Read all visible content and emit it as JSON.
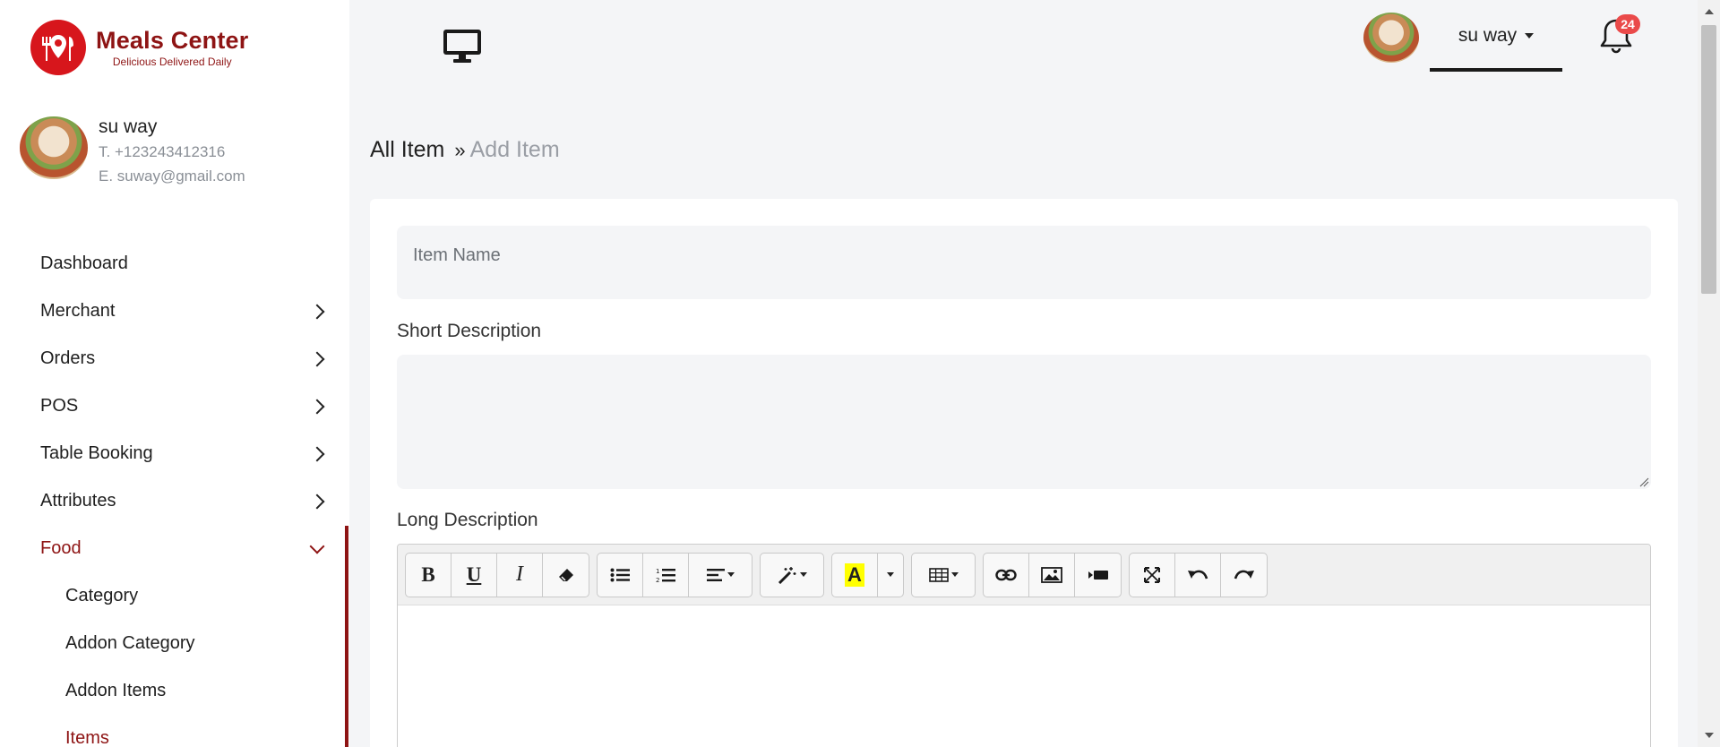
{
  "brand": {
    "title": "Meals Center",
    "tagline": "Delicious Delivered Daily",
    "color": "#8e1414"
  },
  "profile": {
    "name": "su way",
    "phone": "T. +123243412316",
    "email": "E. suway@gmail.com"
  },
  "nav": {
    "items": [
      {
        "label": "Dashboard",
        "has_chevron": false
      },
      {
        "label": "Merchant",
        "has_chevron": true
      },
      {
        "label": "Orders",
        "has_chevron": true
      },
      {
        "label": "POS",
        "has_chevron": true
      },
      {
        "label": "Table Booking",
        "has_chevron": true
      },
      {
        "label": "Attributes",
        "has_chevron": true
      },
      {
        "label": "Food",
        "has_chevron": true,
        "expanded": true,
        "active": true
      }
    ],
    "food_sub": [
      {
        "label": "Category"
      },
      {
        "label": "Addon Category"
      },
      {
        "label": "Addon Items"
      },
      {
        "label": "Items",
        "active": true
      }
    ]
  },
  "header": {
    "display_icon": "desktop-icon",
    "user_name": "su way",
    "notification_count": "24"
  },
  "breadcrumb": {
    "root": "All Item",
    "separator": "»",
    "current": "Add Item"
  },
  "form": {
    "item_name_placeholder": "Item Name",
    "short_description_label": "Short Description",
    "long_description_label": "Long Description"
  },
  "editor_toolbar": {
    "groups": [
      [
        "bold-icon",
        "underline-icon",
        "italic-icon",
        "eraser-icon"
      ],
      [
        "unordered-list-icon",
        "ordered-list-icon",
        "align-dropdown-icon"
      ],
      [
        "magic-style-icon"
      ],
      [
        "highlight-color-icon",
        "color-dropdown-icon"
      ],
      [
        "table-icon"
      ],
      [
        "link-icon",
        "picture-icon",
        "video-icon"
      ],
      [
        "fullscreen-icon",
        "undo-icon",
        "redo-icon"
      ]
    ],
    "highlight_color": "#ffff00"
  }
}
